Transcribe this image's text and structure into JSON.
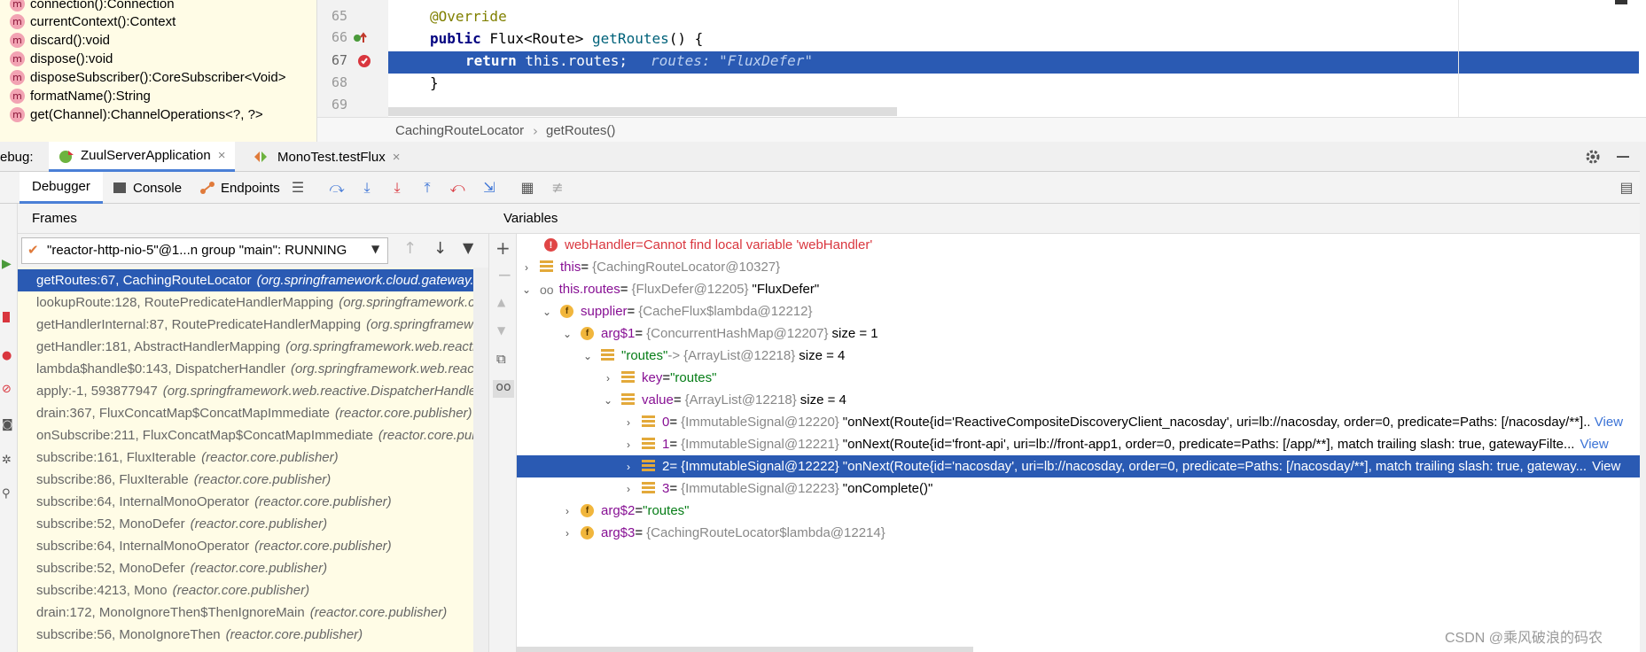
{
  "structure": {
    "items": [
      {
        "name": "connection():Connection"
      },
      {
        "name": "currentContext():Context"
      },
      {
        "name": "discard():void"
      },
      {
        "name": "dispose():void"
      },
      {
        "name": "disposeSubscriber():CoreSubscriber<Void>"
      },
      {
        "name": "formatName():String"
      },
      {
        "name": "get(Channel):ChannelOperations<?, ?>"
      }
    ],
    "method_icon": "m"
  },
  "editor": {
    "lines": [
      "65",
      "66",
      "67",
      "68",
      "69"
    ],
    "code": {
      "l65": "@Override",
      "l66_kw": "public",
      "l66_rest": " Flux<Route> ",
      "l66_fn": "getRoutes",
      "l66_end": "() {",
      "l67_kw": "return",
      "l67_rest": " this.routes;",
      "l67_inline": "routes: \"FluxDefer\"",
      "l68": "}"
    },
    "breadcrumb": [
      "CachingRouteLocator",
      "getRoutes()"
    ],
    "breadcrumb_sep": "›"
  },
  "debug": {
    "label": "ebug:",
    "tabs": [
      {
        "label": "ZuulServerApplication",
        "close": "×"
      },
      {
        "label": "MonoTest.testFlux",
        "close": "×"
      }
    ],
    "toolbar": {
      "debugger": "Debugger",
      "console": "Console",
      "endpoints": "Endpoints"
    }
  },
  "frames": {
    "title": "Frames",
    "thread": "\"reactor-http-nio-5\"@1...n group \"main\": RUNNING",
    "rows": [
      {
        "method": "getRoutes:67, CachingRouteLocator",
        "pkg": "(org.springframework.cloud.gateway.rou"
      },
      {
        "method": "lookupRoute:128, RoutePredicateHandlerMapping",
        "pkg": "(org.springframework.clo"
      },
      {
        "method": "getHandlerInternal:87, RoutePredicateHandlerMapping",
        "pkg": "(org.springframewo"
      },
      {
        "method": "getHandler:181, AbstractHandlerMapping",
        "pkg": "(org.springframework.web.reactiv"
      },
      {
        "method": "lambda$handle$0:143, DispatcherHandler",
        "pkg": "(org.springframework.web.reactiv"
      },
      {
        "method": "apply:-1, 593877947",
        "pkg": "(org.springframework.web.reactive.DispatcherHandler$$"
      },
      {
        "method": "drain:367, FluxConcatMap$ConcatMapImmediate",
        "pkg": "(reactor.core.publisher)"
      },
      {
        "method": "onSubscribe:211, FluxConcatMap$ConcatMapImmediate",
        "pkg": "(reactor.core.publis"
      },
      {
        "method": "subscribe:161, FluxIterable",
        "pkg": "(reactor.core.publisher)"
      },
      {
        "method": "subscribe:86, FluxIterable",
        "pkg": "(reactor.core.publisher)"
      },
      {
        "method": "subscribe:64, InternalMonoOperator",
        "pkg": "(reactor.core.publisher)"
      },
      {
        "method": "subscribe:52, MonoDefer",
        "pkg": "(reactor.core.publisher)"
      },
      {
        "method": "subscribe:64, InternalMonoOperator",
        "pkg": "(reactor.core.publisher)"
      },
      {
        "method": "subscribe:52, MonoDefer",
        "pkg": "(reactor.core.publisher)"
      },
      {
        "method": "subscribe:4213, Mono",
        "pkg": "(reactor.core.publisher)"
      },
      {
        "method": "drain:172, MonoIgnoreThen$ThenIgnoreMain",
        "pkg": "(reactor.core.publisher)"
      },
      {
        "method": "subscribe:56, MonoIgnoreThen",
        "pkg": "(reactor.core.publisher)"
      }
    ]
  },
  "variables": {
    "title": "Variables",
    "rows": [
      {
        "chev": "",
        "icon": "err",
        "name": "webHandler",
        "eq": " = ",
        "type": "",
        "value": "Cannot find local variable 'webHandler'",
        "extra": ""
      },
      {
        "chev": "›",
        "icon": "list",
        "name": "this",
        "eq": " = ",
        "type": "{CachingRouteLocator@10327}",
        "value": "",
        "extra": ""
      },
      {
        "chev": "⌄",
        "icon": "watch",
        "name": "this.routes",
        "eq": " = ",
        "type": "{FluxDefer@12205}",
        "value": "\"FluxDefer\"",
        "extra": ""
      },
      {
        "chev": "⌄",
        "icon": "f",
        "name": "supplier",
        "eq": " = ",
        "type": "{CacheFlux$lambda@12212}",
        "value": "",
        "extra": ""
      },
      {
        "chev": "⌄",
        "icon": "f",
        "name": "arg$1",
        "eq": " = ",
        "type": "{ConcurrentHashMap@12207}",
        "value": "size = 1",
        "extra": ""
      },
      {
        "chev": "⌄",
        "icon": "list",
        "name": "\"routes\"",
        "eq": " -> ",
        "type": "{ArrayList@12218}",
        "value": "size = 4",
        "extra": ""
      },
      {
        "chev": "›",
        "icon": "list",
        "name": "key",
        "eq": " = ",
        "type": "",
        "value": "\"routes\"",
        "extra": ""
      },
      {
        "chev": "⌄",
        "icon": "list",
        "name": "value",
        "eq": " = ",
        "type": "{ArrayList@12218}",
        "value": "size = 4",
        "extra": ""
      },
      {
        "chev": "›",
        "icon": "list",
        "name": "0",
        "eq": " = ",
        "type": "{ImmutableSignal@12220}",
        "value": "\"onNext(Route{id='ReactiveCompositeDiscoveryClient_nacosday', uri=lb://nacosday, order=0, predicate=Paths: [/nacosday/**]...",
        "extra": "View"
      },
      {
        "chev": "›",
        "icon": "list",
        "name": "1",
        "eq": " = ",
        "type": "{ImmutableSignal@12221}",
        "value": "\"onNext(Route{id='front-api', uri=lb://front-app1, order=0, predicate=Paths: [/app/**], match trailing slash: true, gatewayFilte...",
        "extra": "View"
      },
      {
        "chev": "›",
        "icon": "list",
        "name": "2",
        "eq": " = ",
        "type": "{ImmutableSignal@12222}",
        "value": "\"onNext(Route{id='nacosday', uri=lb://nacosday, order=0, predicate=Paths: [/nacosday/**], match trailing slash: true, gateway...",
        "extra": "View"
      },
      {
        "chev": "›",
        "icon": "list",
        "name": "3",
        "eq": " = ",
        "type": "{ImmutableSignal@12223}",
        "value": "\"onComplete()\"",
        "extra": ""
      },
      {
        "chev": "›",
        "icon": "f",
        "name": "arg$2",
        "eq": " = ",
        "type": "",
        "value": "\"routes\"",
        "extra": ""
      },
      {
        "chev": "›",
        "icon": "f",
        "name": "arg$3",
        "eq": " = ",
        "type": "{CachingRouteLocator$lambda@12214}",
        "value": "",
        "extra": ""
      }
    ]
  },
  "watermark": "CSDN @乘风破浪的码农",
  "colors": {
    "selection": "#2a5ab3",
    "frames_bg": "#fffce6",
    "error": "#e04545"
  }
}
